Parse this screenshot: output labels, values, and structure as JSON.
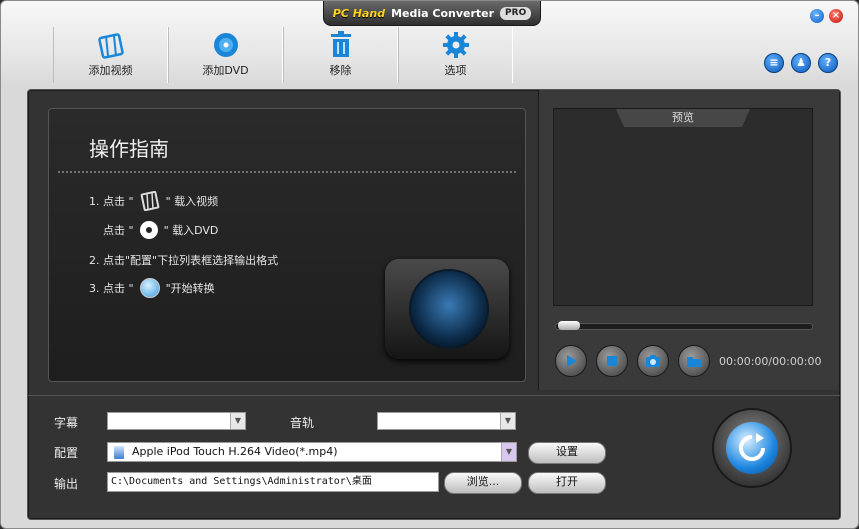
{
  "window": {
    "brand": "PC Hand",
    "title": "Media Converter",
    "badge": "PRO"
  },
  "toolbar": {
    "items": [
      {
        "label": "添加视频",
        "icon": "film-icon"
      },
      {
        "label": "添加DVD",
        "icon": "dvd-icon"
      },
      {
        "label": "移除",
        "icon": "trash-icon"
      },
      {
        "label": "选项",
        "icon": "gear-icon"
      }
    ]
  },
  "guide": {
    "title": "操作指南",
    "step1_prefix": "1. 点击 \"",
    "step1_suffix": "\" 载入视频",
    "step1b_prefix": "点击 \"",
    "step1b_suffix": "\" 载入DVD",
    "step2": "2. 点击\"配置\"下拉列表框选择输出格式",
    "step3_prefix": "3. 点击 \"",
    "step3_suffix": "\"开始转换"
  },
  "preview": {
    "title": "预览",
    "time": "00:00:00/00:00:00"
  },
  "bottom": {
    "subtitle_label": "字幕",
    "audio_label": "音轨",
    "profile_label": "配置",
    "output_label": "输出",
    "profile_value": "Apple iPod Touch H.264 Video(*.mp4)",
    "output_value": "C:\\Documents and Settings\\Administrator\\桌面",
    "settings_button": "设置",
    "browse_button": "浏览...",
    "open_button": "打开"
  }
}
